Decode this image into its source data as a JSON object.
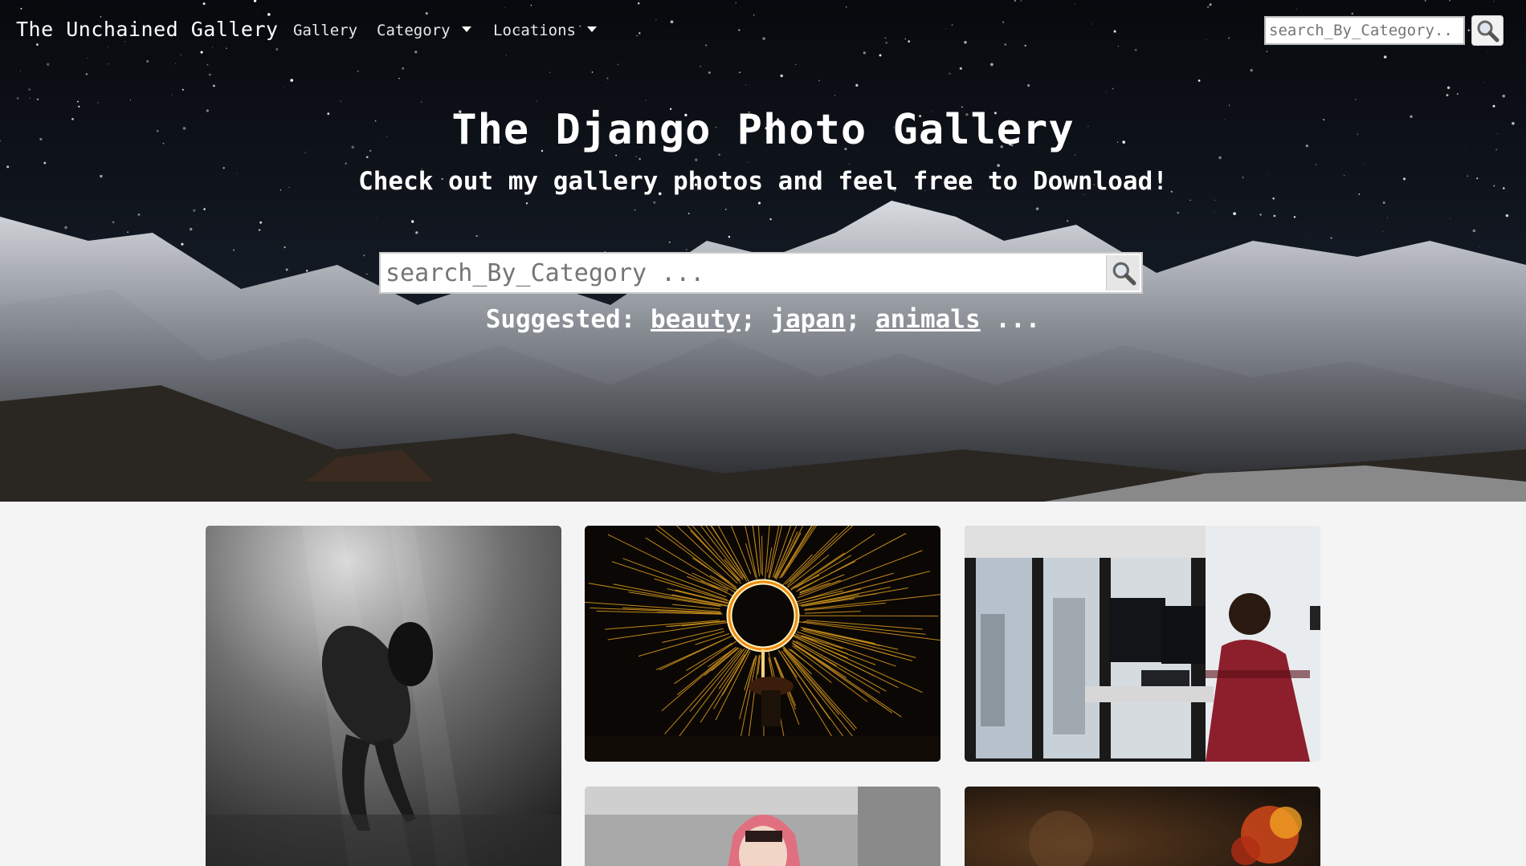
{
  "navbar": {
    "brand": "The Unchained Gallery",
    "links": {
      "gallery": "Gallery",
      "category": "Category",
      "locations": "Locations"
    },
    "search_placeholder": "search_By_Category.."
  },
  "hero": {
    "title": "The Django Photo Gallery",
    "subtitle": "Check out my gallery photos and feel free to Download!",
    "search_placeholder": "search_By_Category ...",
    "suggested_label": "Suggested:",
    "suggestions": [
      "beauty",
      "japan",
      "animals"
    ],
    "suggested_more": "..."
  },
  "gallery": {
    "photos": [
      {
        "subject": "underwater-figure"
      },
      {
        "subject": "steel-wool-fire-spin"
      },
      {
        "subject": "woman-at-computer-desk"
      },
      {
        "subject": "pink-haired-woman"
      },
      {
        "subject": "food-bokeh"
      }
    ]
  },
  "icons": {
    "search": "search-icon",
    "caret": "caret-down-icon"
  }
}
